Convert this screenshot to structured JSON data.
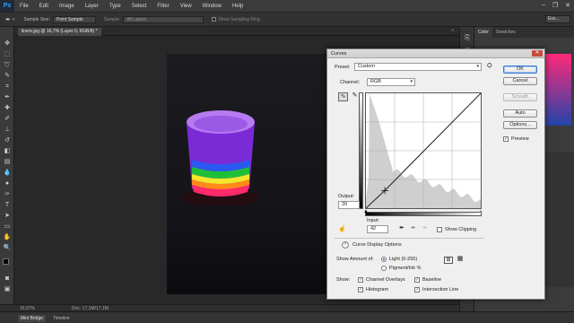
{
  "app": {
    "logo": "Ps"
  },
  "menubar": {
    "items": [
      "File",
      "Edit",
      "Image",
      "Layer",
      "Type",
      "Select",
      "Filter",
      "View",
      "Window",
      "Help"
    ]
  },
  "options": {
    "sample_size_label": "Sample Size:",
    "sample_size_value": "Point Sample",
    "sample_label": "Sample:",
    "sample_value": "All Layers",
    "show_ring_label": "Show Sampling Ring",
    "workspace": "Ess..."
  },
  "document": {
    "tab_title": "liners.jpg @ 16,7% (Layer 0, RGB/8) *",
    "zoom": "16,67%",
    "doc_info": "Doc: 17,1M/17,1M"
  },
  "bottom_tabs": {
    "mini_bridge": "Mini Bridge",
    "timeline": "Timeline"
  },
  "panels": {
    "color_tab": "Color",
    "swatches_tab": "Swatches"
  },
  "curves": {
    "title": "Curves",
    "preset_label": "Preset:",
    "preset_value": "Custom",
    "channel_label": "Channel:",
    "channel_value": "RGB",
    "output_label": "Output:",
    "output_value": "39",
    "input_label": "Input:",
    "input_value": "42",
    "show_clipping_label": "Show Clipping",
    "display_options_label": "Curve Display Options",
    "show_amount_label": "Show Amount of:",
    "light_label": "Light  (0-255)",
    "pigment_label": "Pigment/Ink %",
    "show_label": "Show:",
    "channel_overlays": "Channel Overlays",
    "baseline": "Baseline",
    "histogram": "Histogram",
    "intersection_line": "Intersection Line",
    "buttons": {
      "ok": "OK",
      "cancel": "Cancel",
      "smooth": "Smooth",
      "auto": "Auto",
      "options": "Options..."
    },
    "preview_label": "Preview",
    "point": {
      "input": 42,
      "output": 39
    }
  },
  "colors": {
    "accent": "#1a4da0",
    "ps_blue": "#2ea3f2"
  }
}
